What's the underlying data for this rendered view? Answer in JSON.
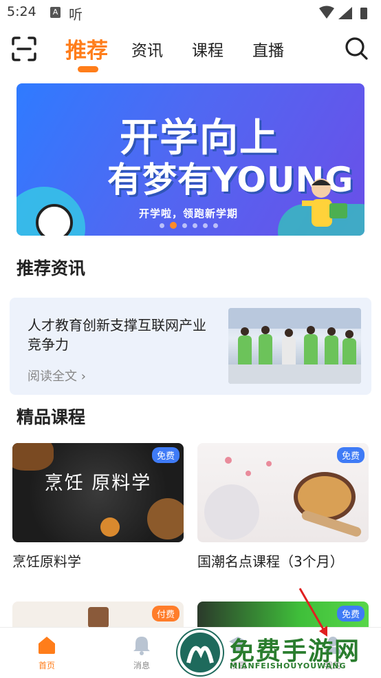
{
  "status": {
    "time": "5:24",
    "ting": "听"
  },
  "nav": {
    "tabs": [
      {
        "label": "推荐",
        "active": true
      },
      {
        "label": "资讯"
      },
      {
        "label": "课程"
      },
      {
        "label": "直播"
      }
    ]
  },
  "banner": {
    "title1": "开学向上",
    "title2": "有梦有YOUNG",
    "subtitle": "开学啦，领跑新学期",
    "slide_count": 6,
    "active_slide": 2
  },
  "news_section": {
    "title": "推荐资讯",
    "item": {
      "title": "人才教育创新支撑互联网产业竞争力",
      "read_label": "阅读全文"
    }
  },
  "courses_section": {
    "title": "精品课程",
    "items": [
      {
        "name": "烹饪原料学",
        "badge": "免费",
        "image_text": "烹饪 原料学"
      },
      {
        "name": "国潮名点课程（3个月）",
        "badge": "免费"
      },
      {
        "name": "",
        "badge": "付费"
      },
      {
        "name": "",
        "badge": "免费"
      }
    ]
  },
  "bottom_nav": [
    {
      "label": "首页",
      "icon": "home-icon",
      "active": true
    },
    {
      "label": "消息",
      "icon": "bell-icon"
    },
    {
      "label": "校园",
      "icon": "school-icon"
    },
    {
      "label": "我的",
      "icon": "user-icon"
    }
  ],
  "watermark": {
    "main": "免费手游网",
    "sub": "MIANFEISHOUYOUWANG"
  },
  "colors": {
    "accent": "#ff7d1a",
    "badge_free": "#3f7bf6",
    "badge_paid": "#ff7d2a"
  }
}
